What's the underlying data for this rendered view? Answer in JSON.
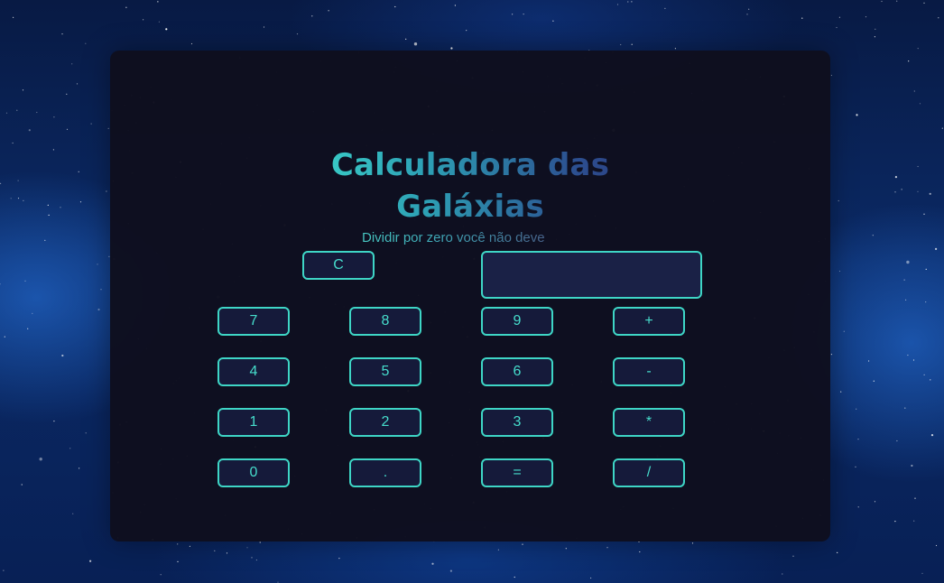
{
  "app": {
    "title": "Calculadora das Galáxias",
    "subtitle": "Dividir por zero você não deve"
  },
  "display": {
    "value": ""
  },
  "buttons": {
    "clear": "C",
    "seven": "7",
    "eight": "8",
    "nine": "9",
    "plus": "+",
    "four": "4",
    "five": "5",
    "six": "6",
    "minus": "-",
    "one": "1",
    "two": "2",
    "three": "3",
    "multiply": "*",
    "zero": "0",
    "dot": ".",
    "equals": "=",
    "divide": "/"
  },
  "colors": {
    "accent": "#3ed6c6",
    "panel": "#0e0e1e",
    "title_start": "#40e6d2",
    "title_end": "#2a3478"
  }
}
